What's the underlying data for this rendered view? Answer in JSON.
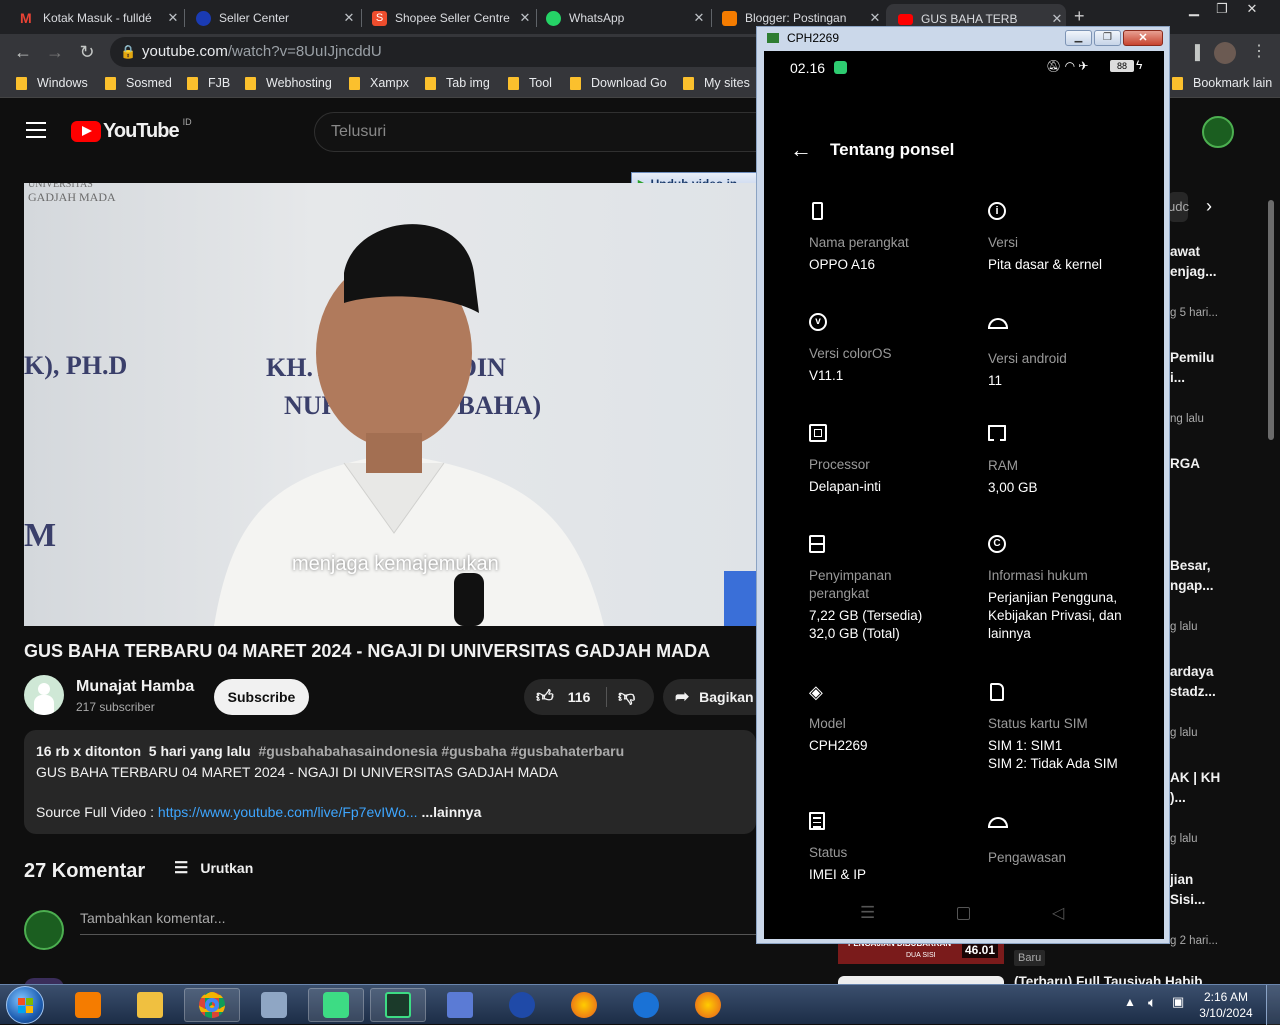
{
  "browser": {
    "tabs": [
      {
        "label": "Kotak Masuk - fulldé",
        "icon": "gmail-icon",
        "color": "#ea4335"
      },
      {
        "label": "Seller Center",
        "icon": "seller-center-icon",
        "color": "#1a3bb3"
      },
      {
        "label": "Shopee Seller Centre",
        "icon": "shopee-icon",
        "color": "#ee4d2d"
      },
      {
        "label": "WhatsApp",
        "icon": "whatsapp-icon",
        "color": "#25d366"
      },
      {
        "label": "Blogger: Postingan",
        "icon": "blogger-icon",
        "color": "#f57c00"
      },
      {
        "label": "GUS BAHA TERB",
        "icon": "youtube-icon",
        "color": "#ff0000"
      }
    ],
    "url_domain": "youtube.com",
    "url_path": "/watch?v=8UuIJjncddU",
    "bookmarks": [
      "Windows",
      "Sosmed",
      "FJB",
      "Webhosting",
      "Xampx",
      "Tab img",
      "Tool",
      "Download Go",
      "My sites"
    ],
    "bookmark_other": "Bookmark lain"
  },
  "youtube": {
    "logo_text": "YouTube",
    "region": "ID",
    "search_placeholder": "Telusuri",
    "download_button": "Unduh video in",
    "video_overlay": {
      "top_left_logo_line1": "UNIVERSITAS",
      "top_left_logo_line2": "GADJAH MADA",
      "name_left": "K), PH.D",
      "name_right_line1": "KH. A      HA'UDDIN",
      "name_right_line2": "NURSA       US BAHA)",
      "letter_m": "M",
      "caption": "menjaga kemajemukan"
    },
    "title": "GUS BAHA TERBARU 04 MARET 2024 - NGAJI DI UNIVERSITAS GADJAH MADA",
    "channel": {
      "name": "Munajat Hamba",
      "subscribers": "217 subscriber",
      "subscribe_label": "Subscribe"
    },
    "likes": "116",
    "share_label": "Bagikan",
    "description": {
      "views": "16 rb x ditonton",
      "age": "5 hari yang lalu",
      "hashtags": "#gusbahabahasaindonesia #gusbaha #gusbahaterbaru",
      "line1": "GUS BAHA TERBARU 04 MARET 2024 - NGAJI DI UNIVERSITAS GADJAH MADA",
      "source_label": "Source Full Video : ",
      "source_link": "https://www.youtube.com/live/Fp7evIWo...",
      "more": "...lainnya"
    },
    "comments": {
      "count_label": "27 Komentar",
      "sort_label": "Urutkan",
      "add_placeholder": "Tambahkan komentar..."
    },
    "sidebar": [
      {
        "chip": "udc"
      },
      {
        "title1": "awat",
        "title2": "enjag...",
        "meta": "g 5 hari..."
      },
      {
        "title1": "Pemilu",
        "title2": "i...",
        "meta": "ng lalu"
      },
      {
        "title1": "RGA"
      },
      {
        "title1": "Besar,",
        "title2": "ngap...",
        "meta": "g lalu"
      },
      {
        "title1": "ardaya",
        "title2": "stadz...",
        "meta": "g lalu"
      },
      {
        "title1": "AK | KH",
        "title2": ")...",
        "meta": "g lalu"
      },
      {
        "title1": "jian",
        "title2": "Sisi...",
        "meta": "g 2 hari..."
      },
      {
        "title1": "(Terbaru) Full Tausiyah Habib"
      }
    ],
    "thumb_bottom": {
      "text1": "PENGAJIAN DIBUBARKAN",
      "text2": "DUA SISI",
      "duration": "46.01",
      "badge": "Baru"
    }
  },
  "phone_window": {
    "title": "CPH2269",
    "status": {
      "time": "02.16",
      "battery": "88"
    },
    "screen_title": "Tentang ponsel",
    "items": [
      {
        "icon": "phone-icon",
        "label": "Nama perangkat",
        "value": "OPPO A16"
      },
      {
        "icon": "info-icon",
        "label": "Versi",
        "value": "Pita dasar & kernel"
      },
      {
        "icon": "coloros-icon",
        "label": "Versi colorOS",
        "value": "V11.1"
      },
      {
        "icon": "android-icon",
        "label": "Versi android",
        "value": "11"
      },
      {
        "icon": "processor-icon",
        "label": "Processor",
        "value": "Delapan-inti"
      },
      {
        "icon": "ram-icon",
        "label": "RAM",
        "value": "3,00 GB"
      },
      {
        "icon": "storage-icon",
        "label": "Penyimpanan perangkat",
        "value": "7,22 GB (Tersedia)\n32,0 GB (Total)"
      },
      {
        "icon": "copyright-icon",
        "label": "Informasi hukum",
        "value": "Perjanjian Pengguna, Kebijakan Privasi, dan lainnya"
      },
      {
        "icon": "layers-icon",
        "label": "Model",
        "value": "CPH2269"
      },
      {
        "icon": "sim-icon",
        "label": "Status kartu SIM",
        "value": "SIM 1: SIM1\nSIM 2: Tidak Ada SIM"
      },
      {
        "icon": "document-icon",
        "label": "Status",
        "value": "IMEI & IP"
      },
      {
        "icon": "android-icon",
        "label": "Pengawasan",
        "value": ""
      }
    ]
  },
  "taskbar": {
    "time": "2:16 AM",
    "date": "3/10/2024",
    "apps": [
      "media-player-icon",
      "file-explorer-icon",
      "chrome-icon",
      "tool-icon",
      "android-studio-icon",
      "scrcpy-icon",
      "network-icon",
      "heart-app-icon",
      "firefox-icon",
      "app-circle-icon",
      "firefox-2-icon"
    ]
  }
}
